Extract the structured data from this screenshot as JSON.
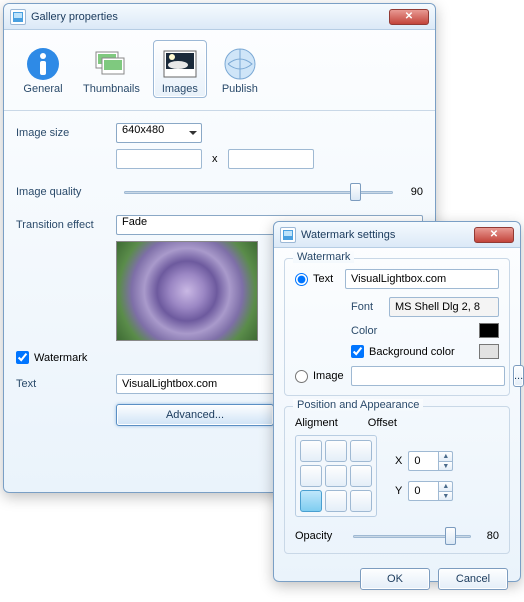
{
  "gallery": {
    "title": "Gallery properties",
    "tabs": {
      "general": "General",
      "thumbnails": "Thumbnails",
      "images": "Images",
      "publish": "Publish"
    },
    "imageSizeLabel": "Image size",
    "imageSize": "640x480",
    "dimX": "x",
    "qualityLabel": "Image quality",
    "quality": "90",
    "transitionLabel": "Transition effect",
    "transition": "Fade",
    "watermarkLabel": "Watermark",
    "textLabel": "Text",
    "textValue": "VisualLightbox.com",
    "advanced": "Advanced..."
  },
  "wm": {
    "title": "Watermark settings",
    "groupWatermark": "Watermark",
    "textOpt": "Text",
    "textValue": "VisualLightbox.com",
    "fontLabel": "Font",
    "fontValue": "MS Shell Dlg 2, 8",
    "colorLabel": "Color",
    "bgColorLabel": "Background color",
    "imageOpt": "Image",
    "browse": "...",
    "groupPos": "Position and Appearance",
    "alignLabel": "Aligment",
    "offsetLabel": "Offset",
    "x": "X",
    "y": "Y",
    "xval": "0",
    "yval": "0",
    "opacityLabel": "Opacity",
    "opacity": "80",
    "ok": "OK",
    "cancel": "Cancel",
    "colorHex": "#000000",
    "bgHex": "#e2e2e2"
  }
}
